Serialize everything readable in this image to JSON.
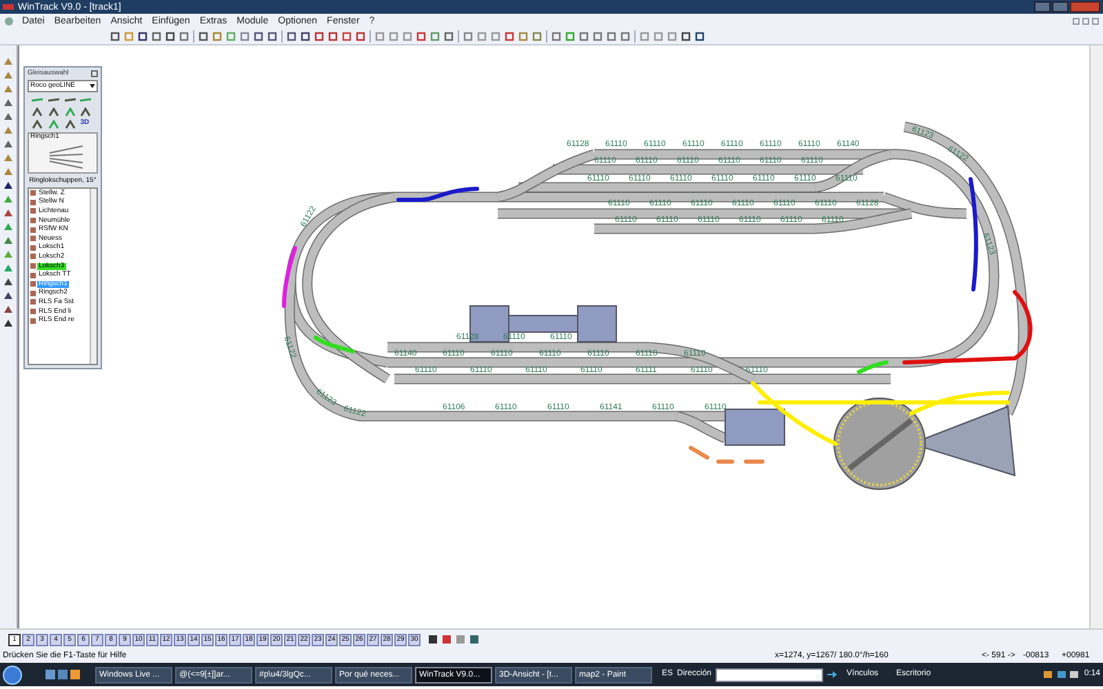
{
  "window": {
    "title": "WinTrack  V9.0 - [track1]"
  },
  "menu": [
    "Datei",
    "Bearbeiten",
    "Ansicht",
    "Einfügen",
    "Extras",
    "Module",
    "Optionen",
    "Fenster",
    "?"
  ],
  "palette": {
    "title": "Gleisauswahl",
    "dropdown": "Roco geoLINE",
    "mode_label": "3D",
    "preview_label": "Ringsch1",
    "caption": "Ringlokschuppen, 15°",
    "items": [
      {
        "label": "Stellw. Z",
        "selected": false
      },
      {
        "label": "Stellw N",
        "selected": false
      },
      {
        "label": "Lichtenau",
        "selected": false
      },
      {
        "label": "Neumühle",
        "selected": false
      },
      {
        "label": "RSfW KN",
        "selected": false
      },
      {
        "label": "Neuess",
        "selected": false
      },
      {
        "label": "Loksch1",
        "selected": false
      },
      {
        "label": "Loksch2",
        "selected": false
      },
      {
        "label": "Loksch3",
        "selected": false,
        "color": "#33dd22"
      },
      {
        "label": "Loksch TT",
        "selected": false
      },
      {
        "label": "Ringsch1",
        "selected": true
      },
      {
        "label": "Ringsch2",
        "selected": false
      },
      {
        "label": "RLS Fa Sst",
        "selected": false
      },
      {
        "label": "RLS End li",
        "selected": false
      },
      {
        "label": "RLS End re",
        "selected": false
      }
    ]
  },
  "track_rows": [
    {
      "labels": [
        "61128",
        "61110",
        "61110",
        "61110",
        "61110",
        "61110",
        "61110",
        "61140"
      ]
    },
    {
      "labels": [
        "61110",
        "61110",
        "61110",
        "61110",
        "61110",
        "61110"
      ]
    },
    {
      "labels": [
        "61110",
        "61110",
        "61110",
        "61110",
        "61110",
        "61110",
        "61110"
      ]
    },
    {
      "labels": [
        "61110",
        "61110",
        "61110",
        "61110",
        "61110",
        "61110",
        "61128"
      ]
    },
    {
      "labels": [
        "61110",
        "61110",
        "61110",
        "61110",
        "61110",
        "61110"
      ]
    },
    {
      "labels": [
        "61128",
        "61110",
        "61110"
      ]
    },
    {
      "labels": [
        "61140",
        "61110",
        "61110",
        "61110",
        "61110",
        "61110",
        "61110"
      ]
    },
    {
      "labels": [
        "61110",
        "61110",
        "61110",
        "61110",
        "61111",
        "61110",
        "61110"
      ]
    },
    {
      "labels": [
        "61106",
        "61110",
        "61110",
        "61141",
        "61110",
        "61110"
      ]
    }
  ],
  "curve_labels": [
    "61123",
    "61122",
    "61123",
    "61122",
    "61122",
    "61123",
    "61122"
  ],
  "page_tabs": [
    {
      "label": "1",
      "selected": true
    },
    {
      "label": "2",
      "selected": false
    },
    {
      "label": "3",
      "selected": false
    },
    {
      "label": "4",
      "selected": false
    },
    {
      "label": "5",
      "selected": false
    },
    {
      "label": "6",
      "selected": false
    },
    {
      "label": "7",
      "selected": false
    },
    {
      "label": "8",
      "selected": false
    },
    {
      "label": "9",
      "selected": false
    },
    {
      "label": "10",
      "selected": false
    },
    {
      "label": "11",
      "selected": false
    },
    {
      "label": "12",
      "selected": false
    },
    {
      "label": "13",
      "selected": false
    },
    {
      "label": "14",
      "selected": false
    },
    {
      "label": "15",
      "selected": false
    },
    {
      "label": "16",
      "selected": false
    },
    {
      "label": "17",
      "selected": false
    },
    {
      "label": "18",
      "selected": false
    },
    {
      "label": "19",
      "selected": false
    },
    {
      "label": "20",
      "selected": false
    },
    {
      "label": "21",
      "selected": false
    },
    {
      "label": "22",
      "selected": false
    },
    {
      "label": "23",
      "selected": false
    },
    {
      "label": "24",
      "selected": false
    },
    {
      "label": "25",
      "selected": false
    },
    {
      "label": "26",
      "selected": false
    },
    {
      "label": "27",
      "selected": false
    },
    {
      "label": "28",
      "selected": false
    },
    {
      "label": "29",
      "selected": false
    },
    {
      "label": "30",
      "selected": false
    }
  ],
  "status_bar": {
    "hint": "Drücken Sie die  F1-Taste für Hilfe",
    "coords": "x=1274, y=1267/ 180.0°/h=160",
    "range": "<- 591 ->",
    "x_value": "-00813",
    "y_value": "+00981"
  },
  "taskbar": {
    "buttons": [
      {
        "label": "Windows Live ...",
        "selected": false
      },
      {
        "label": "@(<=9[±]]ar...",
        "selected": false
      },
      {
        "label": "#p\\u4/3lgQc...",
        "selected": false
      },
      {
        "label": "Por qué neces...",
        "selected": false
      },
      {
        "label": "WinTrack  V9.0...",
        "selected": true
      },
      {
        "label": "3D-Ansicht - [t...",
        "selected": false
      },
      {
        "label": "map2 - Paint",
        "selected": false
      }
    ],
    "language": "ES",
    "address_label": "Dirección",
    "links": "Vínculos",
    "desktop": "Escritorio",
    "time": "0:14"
  }
}
